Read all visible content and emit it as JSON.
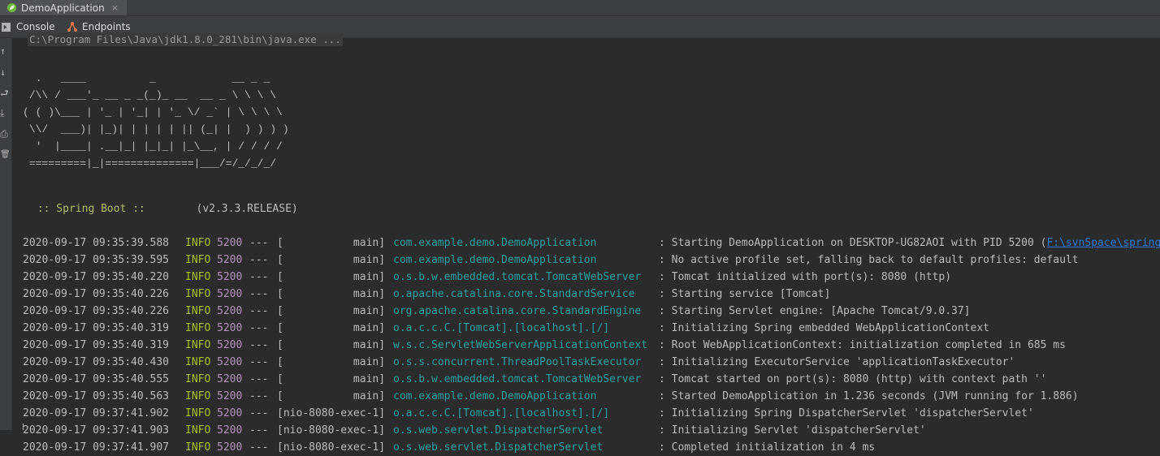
{
  "run_tab": {
    "label": "DemoApplication",
    "close": "×"
  },
  "toolbar": {
    "console_label": "Console",
    "endpoints_label": "Endpoints"
  },
  "gutter": [
    {
      "name": "up-arrow-icon",
      "glyph": "↑"
    },
    {
      "name": "down-arrow-icon",
      "glyph": "↓"
    },
    {
      "name": "soft-wrap-icon",
      "glyph": "⮐"
    },
    {
      "name": "scroll-to-end-icon",
      "glyph": "⤓"
    },
    {
      "name": "print-icon",
      "glyph": "⎙"
    },
    {
      "name": "trash-icon",
      "glyph": "🗑"
    }
  ],
  "console": {
    "command_line": "C:\\Program Files\\Java\\jdk1.8.0_281\\bin\\java.exe ...",
    "banner": "  .   ____          _            __ _ _\n /\\\\ / ___'_ __ _ _(_)_ __  __ _ \\ \\ \\ \\\n( ( )\\___ | '_ | '_| | '_ \\/ _` | \\ \\ \\ \\\n \\\\/  ___)| |_)| | | | | || (_| |  ) ) ) )\n  '  |____| .__|_| |_|_| |_\\__, | / / / /\n =========|_|==============|___/=/_/_/_/",
    "spring_boot_label": " :: Spring Boot :: ",
    "spring_boot_version": "       (v2.3.3.RELEASE)"
  },
  "log_rows": [
    {
      "ts": "2020-09-17 09:35:39.588",
      "level": "INFO",
      "pid": "5200",
      "sep": "---",
      "thread": "[           main]",
      "logger": "com.example.demo.DemoApplication",
      "message": ": Starting DemoApplication on DESKTOP-UG82AOI with PID 5200 (",
      "link": "F:\\svnSpace\\spring"
    },
    {
      "ts": "2020-09-17 09:35:39.595",
      "level": "INFO",
      "pid": "5200",
      "sep": "---",
      "thread": "[           main]",
      "logger": "com.example.demo.DemoApplication",
      "message": ": No active profile set, falling back to default profiles: default",
      "link": ""
    },
    {
      "ts": "2020-09-17 09:35:40.220",
      "level": "INFO",
      "pid": "5200",
      "sep": "---",
      "thread": "[           main]",
      "logger": "o.s.b.w.embedded.tomcat.TomcatWebServer",
      "message": ": Tomcat initialized with port(s): 8080 (http)",
      "link": ""
    },
    {
      "ts": "2020-09-17 09:35:40.226",
      "level": "INFO",
      "pid": "5200",
      "sep": "---",
      "thread": "[           main]",
      "logger": "o.apache.catalina.core.StandardService",
      "message": ": Starting service [Tomcat]",
      "link": ""
    },
    {
      "ts": "2020-09-17 09:35:40.226",
      "level": "INFO",
      "pid": "5200",
      "sep": "---",
      "thread": "[           main]",
      "logger": "org.apache.catalina.core.StandardEngine",
      "message": ": Starting Servlet engine: [Apache Tomcat/9.0.37]",
      "link": ""
    },
    {
      "ts": "2020-09-17 09:35:40.319",
      "level": "INFO",
      "pid": "5200",
      "sep": "---",
      "thread": "[           main]",
      "logger": "o.a.c.c.C.[Tomcat].[localhost].[/]",
      "message": ": Initializing Spring embedded WebApplicationContext",
      "link": ""
    },
    {
      "ts": "2020-09-17 09:35:40.319",
      "level": "INFO",
      "pid": "5200",
      "sep": "---",
      "thread": "[           main]",
      "logger": "w.s.c.ServletWebServerApplicationContext",
      "message": ": Root WebApplicationContext: initialization completed in 685 ms",
      "link": ""
    },
    {
      "ts": "2020-09-17 09:35:40.430",
      "level": "INFO",
      "pid": "5200",
      "sep": "---",
      "thread": "[           main]",
      "logger": "o.s.s.concurrent.ThreadPoolTaskExecutor",
      "message": ": Initializing ExecutorService 'applicationTaskExecutor'",
      "link": ""
    },
    {
      "ts": "2020-09-17 09:35:40.555",
      "level": "INFO",
      "pid": "5200",
      "sep": "---",
      "thread": "[           main]",
      "logger": "o.s.b.w.embedded.tomcat.TomcatWebServer",
      "message": ": Tomcat started on port(s): 8080 (http) with context path ''",
      "link": ""
    },
    {
      "ts": "2020-09-17 09:35:40.563",
      "level": "INFO",
      "pid": "5200",
      "sep": "---",
      "thread": "[           main]",
      "logger": "com.example.demo.DemoApplication",
      "message": ": Started DemoApplication in 1.236 seconds (JVM running for 1.886)",
      "link": ""
    },
    {
      "ts": "2020-09-17 09:37:41.902",
      "level": "INFO",
      "pid": "5200",
      "sep": "---",
      "thread": "[nio-8080-exec-1]",
      "logger": "o.a.c.c.C.[Tomcat].[localhost].[/]",
      "message": ": Initializing Spring DispatcherServlet 'dispatcherServlet'",
      "link": ""
    },
    {
      "ts": "2020-09-17 09:37:41.903",
      "level": "INFO",
      "pid": "5200",
      "sep": "---",
      "thread": "[nio-8080-exec-1]",
      "logger": "o.s.web.servlet.DispatcherServlet",
      "message": ": Initializing Servlet 'dispatcherServlet'",
      "link": ""
    },
    {
      "ts": "2020-09-17 09:37:41.907",
      "level": "INFO",
      "pid": "5200",
      "sep": "---",
      "thread": "[nio-8080-exec-1]",
      "logger": "o.s.web.servlet.DispatcherServlet",
      "message": ": Completed initialization in 4 ms",
      "link": ""
    }
  ],
  "colors": {
    "background": "#2b2b2b",
    "level_info": "#a8c023",
    "pid": "#b294bb",
    "logger": "#28a0a0",
    "link": "#287bde",
    "spring_boot": "#b5bd68"
  }
}
